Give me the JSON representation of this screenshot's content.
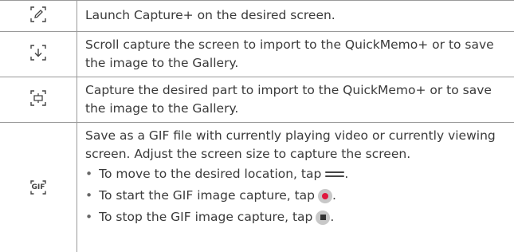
{
  "rows": [
    {
      "icon": "edit-capture-icon",
      "text": "Launch Capture+ on the desired screen."
    },
    {
      "icon": "scroll-capture-icon",
      "text": "Scroll capture the screen to import to the QuickMemo+ or to save the image to the Gallery."
    },
    {
      "icon": "partial-capture-icon",
      "text": "Capture the desired part to import to the QuickMemo+ or to save the image to the Gallery."
    },
    {
      "icon": "gif-capture-icon",
      "icon_text": "GIF",
      "text": "Save as a GIF file with currently playing video or currently viewing screen. Adjust the screen size to capture the screen.",
      "bullets": [
        {
          "text": "To move to the desired location, tap",
          "button_icon": "move-handle-icon"
        },
        {
          "text": "To start the GIF image capture, tap",
          "button_icon": "record-button-icon"
        },
        {
          "text": "To stop the GIF image capture, tap",
          "button_icon": "stop-button-icon"
        }
      ]
    }
  ],
  "colors": {
    "border": "#9a9a9a",
    "text": "#3a3a3a",
    "record_red": "#e0193f"
  }
}
